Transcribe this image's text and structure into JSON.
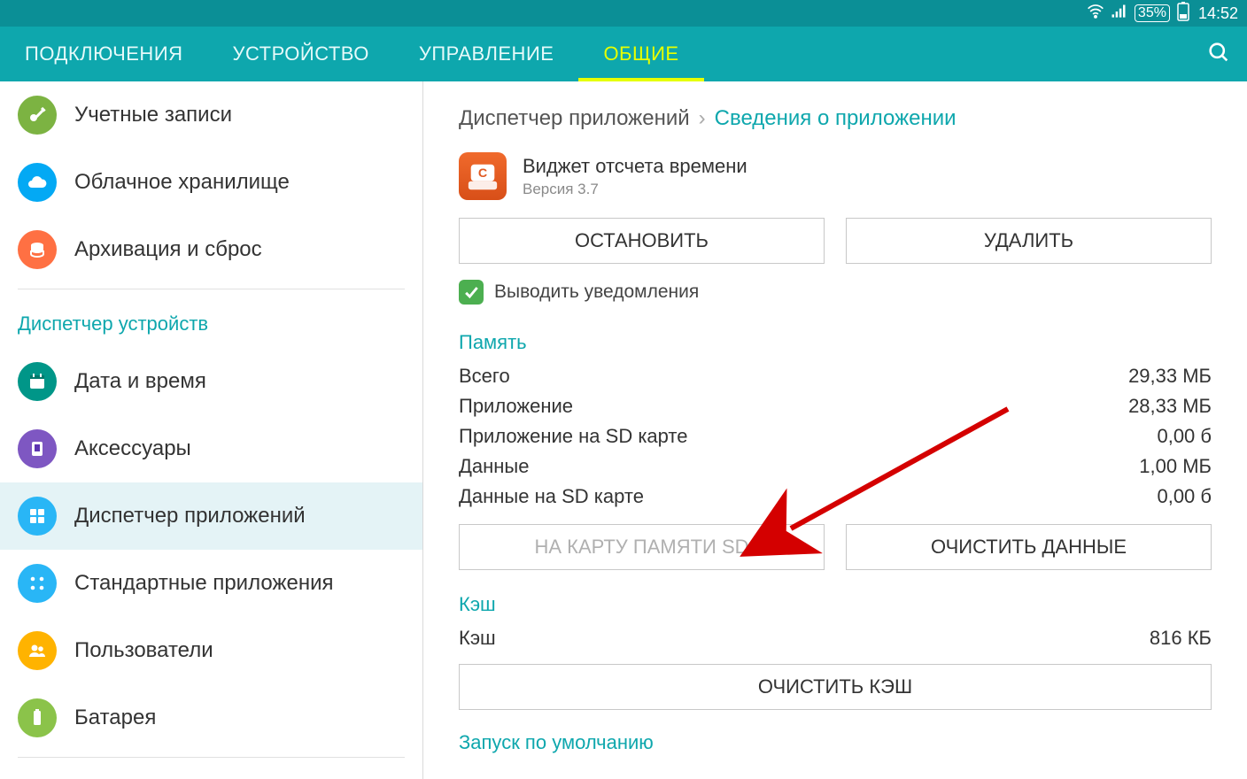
{
  "statusbar": {
    "battery_percent": "35%",
    "time": "14:52"
  },
  "tabs": {
    "t0": "ПОДКЛЮЧЕНИЯ",
    "t1": "УСТРОЙСТВО",
    "t2": "УПРАВЛЕНИЕ",
    "t3": "ОБЩИЕ"
  },
  "sidebar": {
    "items": [
      {
        "label": "Учетные записи"
      },
      {
        "label": "Облачное хранилище"
      },
      {
        "label": "Архивация и сброс"
      }
    ],
    "header": "Диспетчер устройств",
    "items2": [
      {
        "label": "Дата и время"
      },
      {
        "label": "Аксессуары"
      },
      {
        "label": "Диспетчер приложений"
      },
      {
        "label": "Стандартные приложения"
      },
      {
        "label": "Пользователи"
      },
      {
        "label": "Батарея"
      }
    ]
  },
  "main": {
    "breadcrumb": {
      "a": "Диспетчер приложений",
      "b": "Сведения о приложении"
    },
    "app": {
      "name": "Виджет отсчета времени",
      "version": "Версия 3.7"
    },
    "buttons": {
      "stop": "ОСТАНОВИТЬ",
      "delete": "УДАЛИТЬ",
      "to_sd": "НА КАРТУ ПАМЯТИ SD",
      "clear_data": "ОЧИСТИТЬ ДАННЫЕ",
      "clear_cache": "ОЧИСТИТЬ КЭШ"
    },
    "checkbox_label": "Выводить уведомления",
    "sections": {
      "memory": "Память",
      "cache": "Кэш",
      "launch": "Запуск по умолчанию"
    },
    "memory": {
      "total_k": "Всего",
      "total_v": "29,33 МБ",
      "app_k": "Приложение",
      "app_v": "28,33 МБ",
      "appsd_k": "Приложение на SD карте",
      "appsd_v": "0,00 б",
      "data_k": "Данные",
      "data_v": "1,00 МБ",
      "datasd_k": "Данные на SD карте",
      "datasd_v": "0,00 б"
    },
    "cache": {
      "cache_k": "Кэш",
      "cache_v": "816 КБ"
    }
  }
}
